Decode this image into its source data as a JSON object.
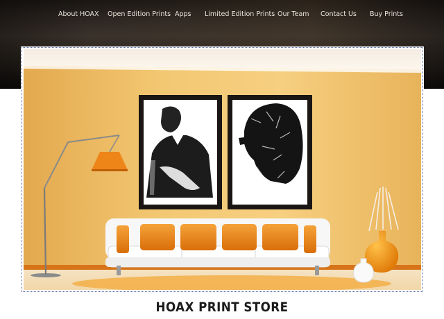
{
  "nav": {
    "items": [
      {
        "label": "About HOAX"
      },
      {
        "label": "Open Edition Prints"
      },
      {
        "label": "Apps"
      },
      {
        "label": "Limited Edition Prints"
      },
      {
        "label": "Our Team"
      },
      {
        "label": "Contact Us"
      },
      {
        "label": "Buy Prints"
      }
    ]
  },
  "hero": {
    "image": "room-interior-with-two-framed-portrait-prints"
  },
  "store": {
    "title": "HOAX PRINT STORE"
  },
  "colors": {
    "header_bg": "#2a2420",
    "wall": "#efc06a",
    "accent_orange": "#e88a1a",
    "text_dark": "#1b1b1b"
  }
}
